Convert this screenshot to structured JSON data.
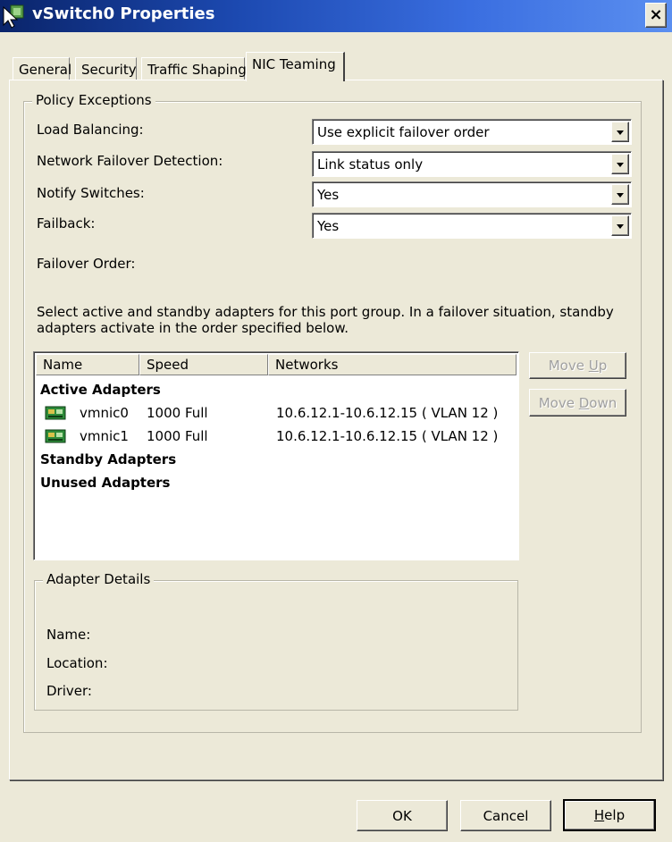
{
  "window": {
    "title": "vSwitch0 Properties",
    "close_label": "×"
  },
  "tabs": [
    {
      "label": "General"
    },
    {
      "label": "Security"
    },
    {
      "label": "Traffic Shaping"
    },
    {
      "label": "NIC Teaming",
      "active": true
    }
  ],
  "policy": {
    "legend": "Policy Exceptions",
    "load_balancing": {
      "label": "Load Balancing:",
      "value": "Use explicit failover order"
    },
    "failover_detection": {
      "label": "Network Failover Detection:",
      "value": "Link status only"
    },
    "notify_switches": {
      "label": "Notify Switches:",
      "value": "Yes"
    },
    "failback": {
      "label": "Failback:",
      "value": "Yes"
    },
    "failover_order_label": "Failover Order:",
    "instructions_line1": "Select active and standby adapters for this port group.  In a failover situation, standby",
    "instructions_line2": "adapters activate  in the order specified below."
  },
  "adapter_list": {
    "columns": [
      "Name",
      "Speed",
      "Networks"
    ],
    "active_label": "Active Adapters",
    "standby_label": "Standby Adapters",
    "unused_label": "Unused Adapters",
    "rows": [
      {
        "name": "vmnic0",
        "speed": "1000 Full",
        "networks": "10.6.12.1-10.6.12.15 ( VLAN 12 )"
      },
      {
        "name": "vmnic1",
        "speed": "1000 Full",
        "networks": "10.6.12.1-10.6.12.15 ( VLAN 12 )"
      }
    ]
  },
  "move_buttons": {
    "up_prefix": "Move ",
    "up_key": "U",
    "up_suffix": "p",
    "down_prefix": "Move ",
    "down_key": "D",
    "down_suffix": "own"
  },
  "details": {
    "legend": "Adapter Details",
    "name_label": "Name:",
    "location_label": "Location:",
    "driver_label": "Driver:"
  },
  "footer": {
    "ok_label": "OK",
    "cancel_label": "Cancel",
    "help_key": "H",
    "help_rest": "elp"
  },
  "colors": {
    "face": "#ECE9D8",
    "title_start": "#0A246A",
    "title_end": "#5B8FF0",
    "nic_green": "#2E8B3A"
  }
}
